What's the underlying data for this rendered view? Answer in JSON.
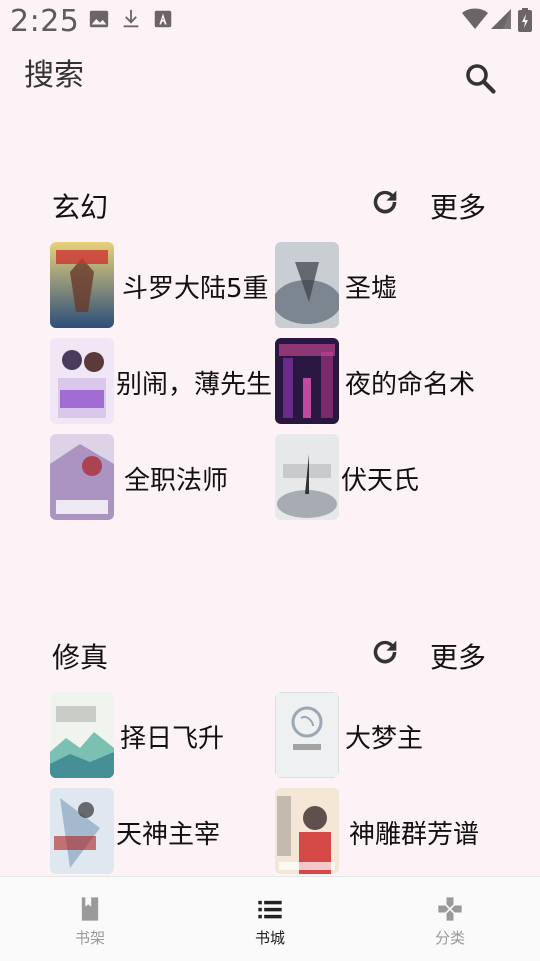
{
  "status_bar": {
    "time": "2:25"
  },
  "header": {
    "title": "搜索"
  },
  "sections": [
    {
      "title": "玄幻",
      "more_label": "更多",
      "books": [
        {
          "title": "斗罗大陆5重"
        },
        {
          "title": "圣墟"
        },
        {
          "title": "别闹，薄先生"
        },
        {
          "title": "夜的命名术"
        },
        {
          "title": "全职法师"
        },
        {
          "title": "伏天氏"
        }
      ]
    },
    {
      "title": "修真",
      "more_label": "更多",
      "books": [
        {
          "title": "择日飞升"
        },
        {
          "title": "大梦主"
        },
        {
          "title": "天神主宰"
        },
        {
          "title": "神雕群芳谱"
        }
      ]
    }
  ],
  "bottom_nav": {
    "tabs": [
      {
        "label": "书架",
        "icon": "book-icon"
      },
      {
        "label": "书城",
        "icon": "list-icon"
      },
      {
        "label": "分类",
        "icon": "gamepad-icon"
      }
    ]
  },
  "colors": {
    "background": "#fdf2f6",
    "tab_inactive": "#9a9a9a",
    "tab_active": "#222222"
  }
}
